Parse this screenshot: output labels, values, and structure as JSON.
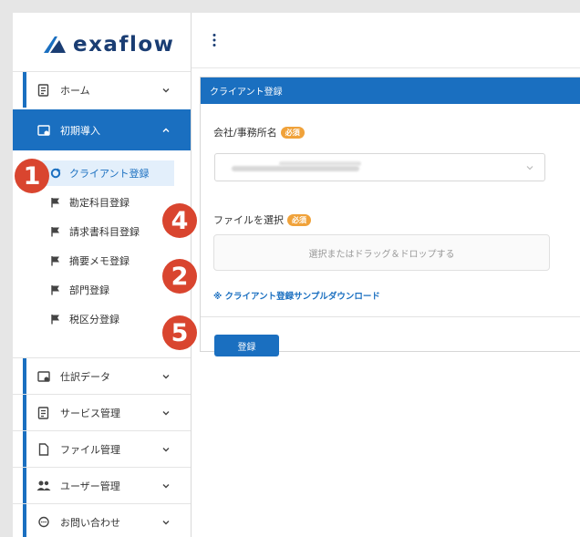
{
  "app": {
    "logo_text": "exaflow"
  },
  "sidebar": {
    "items": [
      {
        "label": "ホーム",
        "icon": "document-icon"
      },
      {
        "label": "初期導入",
        "icon": "setup-icon"
      },
      {
        "label": "仕訳データ",
        "icon": "setup-icon"
      },
      {
        "label": "サービス管理",
        "icon": "document-icon"
      },
      {
        "label": "ファイル管理",
        "icon": "file-icon"
      },
      {
        "label": "ユーザー管理",
        "icon": "users-icon"
      },
      {
        "label": "お問い合わせ",
        "icon": "chat-icon"
      }
    ],
    "subitems": [
      {
        "label": "クライアント登録",
        "icon": "refresh-icon"
      },
      {
        "label": "勘定科目登録",
        "icon": "flag-icon"
      },
      {
        "label": "請求書科目登録",
        "icon": "flag-icon"
      },
      {
        "label": "摘要メモ登録",
        "icon": "flag-icon"
      },
      {
        "label": "部門登録",
        "icon": "flag-icon"
      },
      {
        "label": "税区分登録",
        "icon": "flag-icon"
      }
    ]
  },
  "form": {
    "title": "クライアント登録",
    "company_label": "会社/事務所名",
    "required": "必須",
    "file_label": "ファイルを選択",
    "dropzone_text": "選択またはドラッグ＆ドロップする",
    "download_link": "※ クライアント登録サンプルダウンロード",
    "submit": "登録"
  },
  "annotations": [
    "1",
    "4",
    "2",
    "5"
  ],
  "colors": {
    "primary": "#1a6fc0",
    "badge": "#d9452f",
    "required": "#f0a23a",
    "logo": "#1a3d73"
  }
}
